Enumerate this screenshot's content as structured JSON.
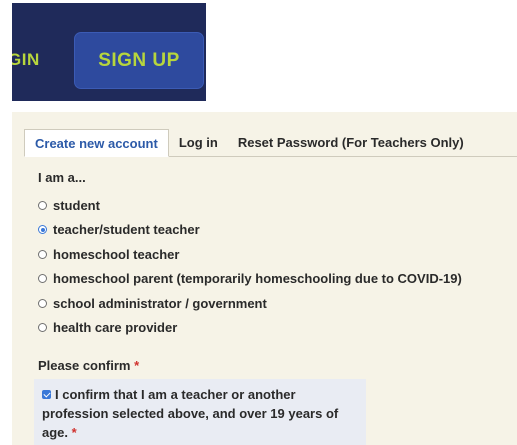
{
  "banner": {
    "signin_fragment": "GIN",
    "signup_label": "SIGN UP"
  },
  "tabs": [
    {
      "label": "Create new account",
      "active": true
    },
    {
      "label": "Log in",
      "active": false
    },
    {
      "label": "Reset Password (For Teachers Only)",
      "active": false
    }
  ],
  "role": {
    "label": "I am a...",
    "options": [
      {
        "label": "student",
        "checked": false
      },
      {
        "label": "teacher/student teacher",
        "checked": true
      },
      {
        "label": "homeschool teacher",
        "checked": false
      },
      {
        "label": "homeschool parent (temporarily homeschooling due to COVID-19)",
        "checked": false
      },
      {
        "label": "school administrator / government",
        "checked": false
      },
      {
        "label": "health care provider",
        "checked": false
      }
    ]
  },
  "confirm": {
    "label": "Please confirm",
    "required_marker": "*",
    "checkbox_text": "I confirm that I am a teacher or another profession selected above, and over 19 years of age.",
    "checkbox_required_marker": "*",
    "checked": true
  },
  "colors": {
    "banner_bg": "#1f2a5a",
    "accent_green": "#b7d63d",
    "signup_bg": "#2e4a9e",
    "panel_bg": "#f6f3e7",
    "active_tab_text": "#2c5aa8",
    "radio_blue": "#3a78d8",
    "required_red": "#d0312d"
  }
}
